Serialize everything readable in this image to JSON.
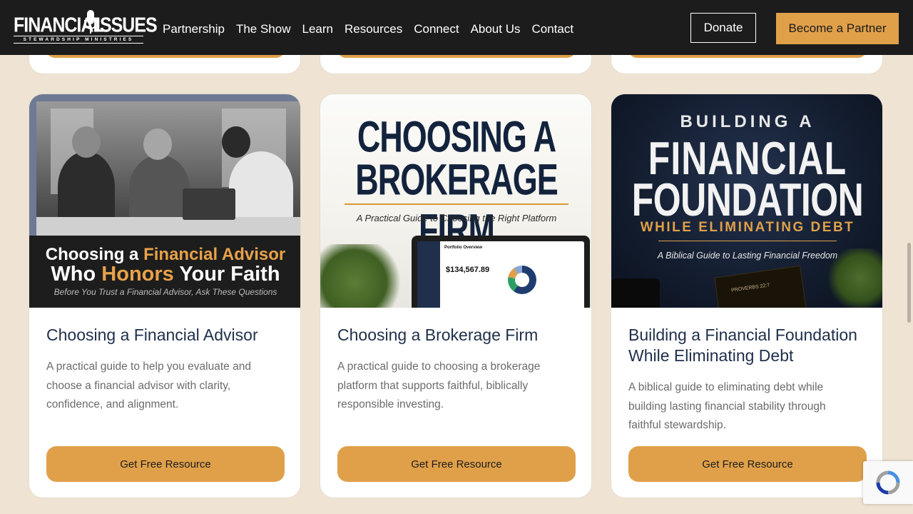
{
  "header": {
    "logo_word_1": "FINANCIAL",
    "logo_word_2": "ISSUES",
    "logo_tagline": "STEWARDSHIP MINISTRIES",
    "nav": [
      "Partnership",
      "The Show",
      "Learn",
      "Resources",
      "Connect",
      "About Us",
      "Contact"
    ],
    "donate_label": "Donate",
    "partner_label": "Become a Partner"
  },
  "cards": [
    {
      "image": {
        "line1_a": "Choosing a ",
        "line1_b": "Financial Advisor",
        "line2_a": "Who ",
        "line2_b": "Honors",
        "line2_c": " Your Faith",
        "line3": "Before You Trust a Financial Advisor, Ask These Questions"
      },
      "title": "Choosing a Financial Advisor",
      "description": "A practical guide to help you evaluate and choose a financial advisor with clarity, confidence, and alignment.",
      "cta": "Get Free Resource"
    },
    {
      "image": {
        "line1": "CHOOSING A",
        "line2": "BROKERAGE FIRM",
        "subtitle": "A Practical Guide to Choosing the Right Platform",
        "screen_title": "Portfolio Overview",
        "screen_value": "$134,567.89"
      },
      "title": "Choosing a Brokerage Firm",
      "description": "A practical guide to choosing a brokerage platform that supports faithful, biblically responsible investing.",
      "cta": "Get Free Resource"
    },
    {
      "image": {
        "line1": "BUILDING A",
        "line2": "FINANCIAL",
        "line3": "FOUNDATION",
        "line4": "WHILE ELIMINATING DEBT",
        "subtitle": "A Biblical Guide to Lasting Financial Freedom",
        "verse": "PROVERBS 22:7"
      },
      "title": "Building a Financial Foundation While Eliminating Debt",
      "description": "A biblical guide to eliminating debt while building lasting financial stability through faithful stewardship.",
      "cta": "Get Free Resource"
    }
  ],
  "colors": {
    "page_background": "#efe4d3",
    "header_background": "#1c1c1c",
    "accent": "#e0a04a",
    "title_navy": "#1e2f4a"
  }
}
